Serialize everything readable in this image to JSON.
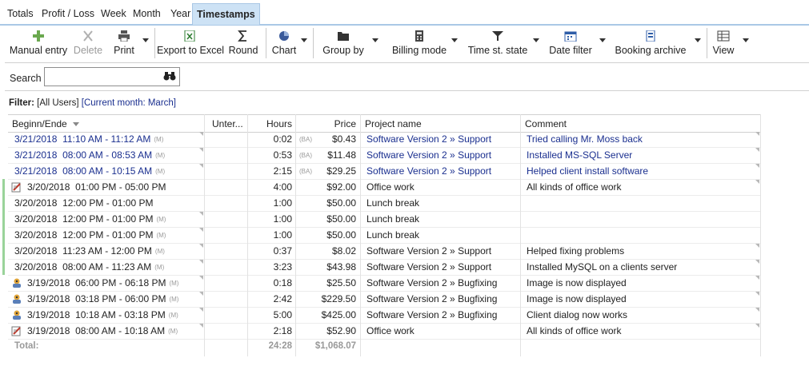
{
  "tabs": [
    {
      "label": "Totals"
    },
    {
      "label": "Profit / Loss"
    },
    {
      "label": "Week"
    },
    {
      "label": "Month"
    },
    {
      "label": "Year"
    },
    {
      "label": "Timestamps"
    }
  ],
  "toolbar": {
    "manual_entry": "Manual entry",
    "delete": "Delete",
    "print": "Print",
    "export_excel": "Export to Excel",
    "round": "Round",
    "chart": "Chart",
    "group_by": "Group by",
    "billing_mode": "Billing mode",
    "time_state": "Time st. state",
    "date_filter": "Date filter",
    "booking_archive": "Booking archive",
    "view": "View"
  },
  "search": {
    "label": "Search",
    "value": ""
  },
  "filter": {
    "label": "Filter:",
    "users": "[All Users]",
    "month": "[Current month: March]"
  },
  "table": {
    "columns": [
      "Beginn/Ende",
      "Unter...",
      "Hours",
      "Price",
      "Project name",
      "Comment"
    ],
    "rows": [
      {
        "date": "3/21/2018",
        "time": "11:10 AM - 11:12 AM",
        "tag": "(M)",
        "hours": "0:02",
        "bill": "(BA)",
        "price": "$0.43",
        "project": "Software Version 2 » Support",
        "comment": "Tried calling Mr. Moss back"
      },
      {
        "date": "3/21/2018",
        "time": "08:00 AM - 08:53 AM",
        "tag": "(M)",
        "hours": "0:53",
        "bill": "(BA)",
        "price": "$11.48",
        "project": "Software Version 2 » Support",
        "comment": "Installed MS-SQL Server"
      },
      {
        "date": "3/21/2018",
        "time": "08:00 AM - 10:15 AM",
        "tag": "(M)",
        "hours": "2:15",
        "bill": "(BA)",
        "price": "$29.25",
        "project": "Software Version 2 » Support",
        "comment": "Helped client install software"
      },
      {
        "date": "3/20/2018",
        "time": "01:00 PM - 05:00 PM",
        "tag": "",
        "hours": "4:00",
        "bill": "",
        "price": "$92.00",
        "project": "Office work",
        "comment": "All kinds of office work"
      },
      {
        "date": "3/20/2018",
        "time": "12:00 PM - 01:00 PM",
        "tag": "",
        "hours": "1:00",
        "bill": "",
        "price": "$50.00",
        "project": "Lunch break",
        "comment": ""
      },
      {
        "date": "3/20/2018",
        "time": "12:00 PM - 01:00 PM",
        "tag": "(M)",
        "hours": "1:00",
        "bill": "",
        "price": "$50.00",
        "project": "Lunch break",
        "comment": ""
      },
      {
        "date": "3/20/2018",
        "time": "12:00 PM - 01:00 PM",
        "tag": "(M)",
        "hours": "1:00",
        "bill": "",
        "price": "$50.00",
        "project": "Lunch break",
        "comment": ""
      },
      {
        "date": "3/20/2018",
        "time": "11:23 AM - 12:00 PM",
        "tag": "(M)",
        "hours": "0:37",
        "bill": "",
        "price": "$8.02",
        "project": "Software Version 2 » Support",
        "comment": "Helped fixing problems"
      },
      {
        "date": "3/20/2018",
        "time": "08:00 AM - 11:23 AM",
        "tag": "(M)",
        "hours": "3:23",
        "bill": "",
        "price": "$43.98",
        "project": "Software Version 2 » Support",
        "comment": "Installed MySQL on a clients server"
      },
      {
        "date": "3/19/2018",
        "time": "06:00 PM - 06:18 PM",
        "tag": "(M)",
        "hours": "0:18",
        "bill": "",
        "price": "$25.50",
        "project": "Software Version 2 » Bugfixing",
        "comment": "Image is now displayed"
      },
      {
        "date": "3/19/2018",
        "time": "03:18 PM - 06:00 PM",
        "tag": "(M)",
        "hours": "2:42",
        "bill": "",
        "price": "$229.50",
        "project": "Software Version 2 » Bugfixing",
        "comment": "Image is now displayed"
      },
      {
        "date": "3/19/2018",
        "time": "10:18 AM - 03:18 PM",
        "tag": "(M)",
        "hours": "5:00",
        "bill": "",
        "price": "$425.00",
        "project": "Software Version 2 » Bugfixing",
        "comment": "Client dialog now works"
      },
      {
        "date": "3/19/2018",
        "time": "08:00 AM - 10:18 AM",
        "tag": "(M)",
        "hours": "2:18",
        "bill": "",
        "price": "$52.90",
        "project": "Office work",
        "comment": "All kinds of office work"
      }
    ],
    "total": {
      "label": "Total:",
      "hours": "24:28",
      "price": "$1,068.07"
    }
  },
  "colors": {
    "accent": "#1a2f8f",
    "tab_active": "#cde2f5",
    "marker": "#9ad39a"
  }
}
